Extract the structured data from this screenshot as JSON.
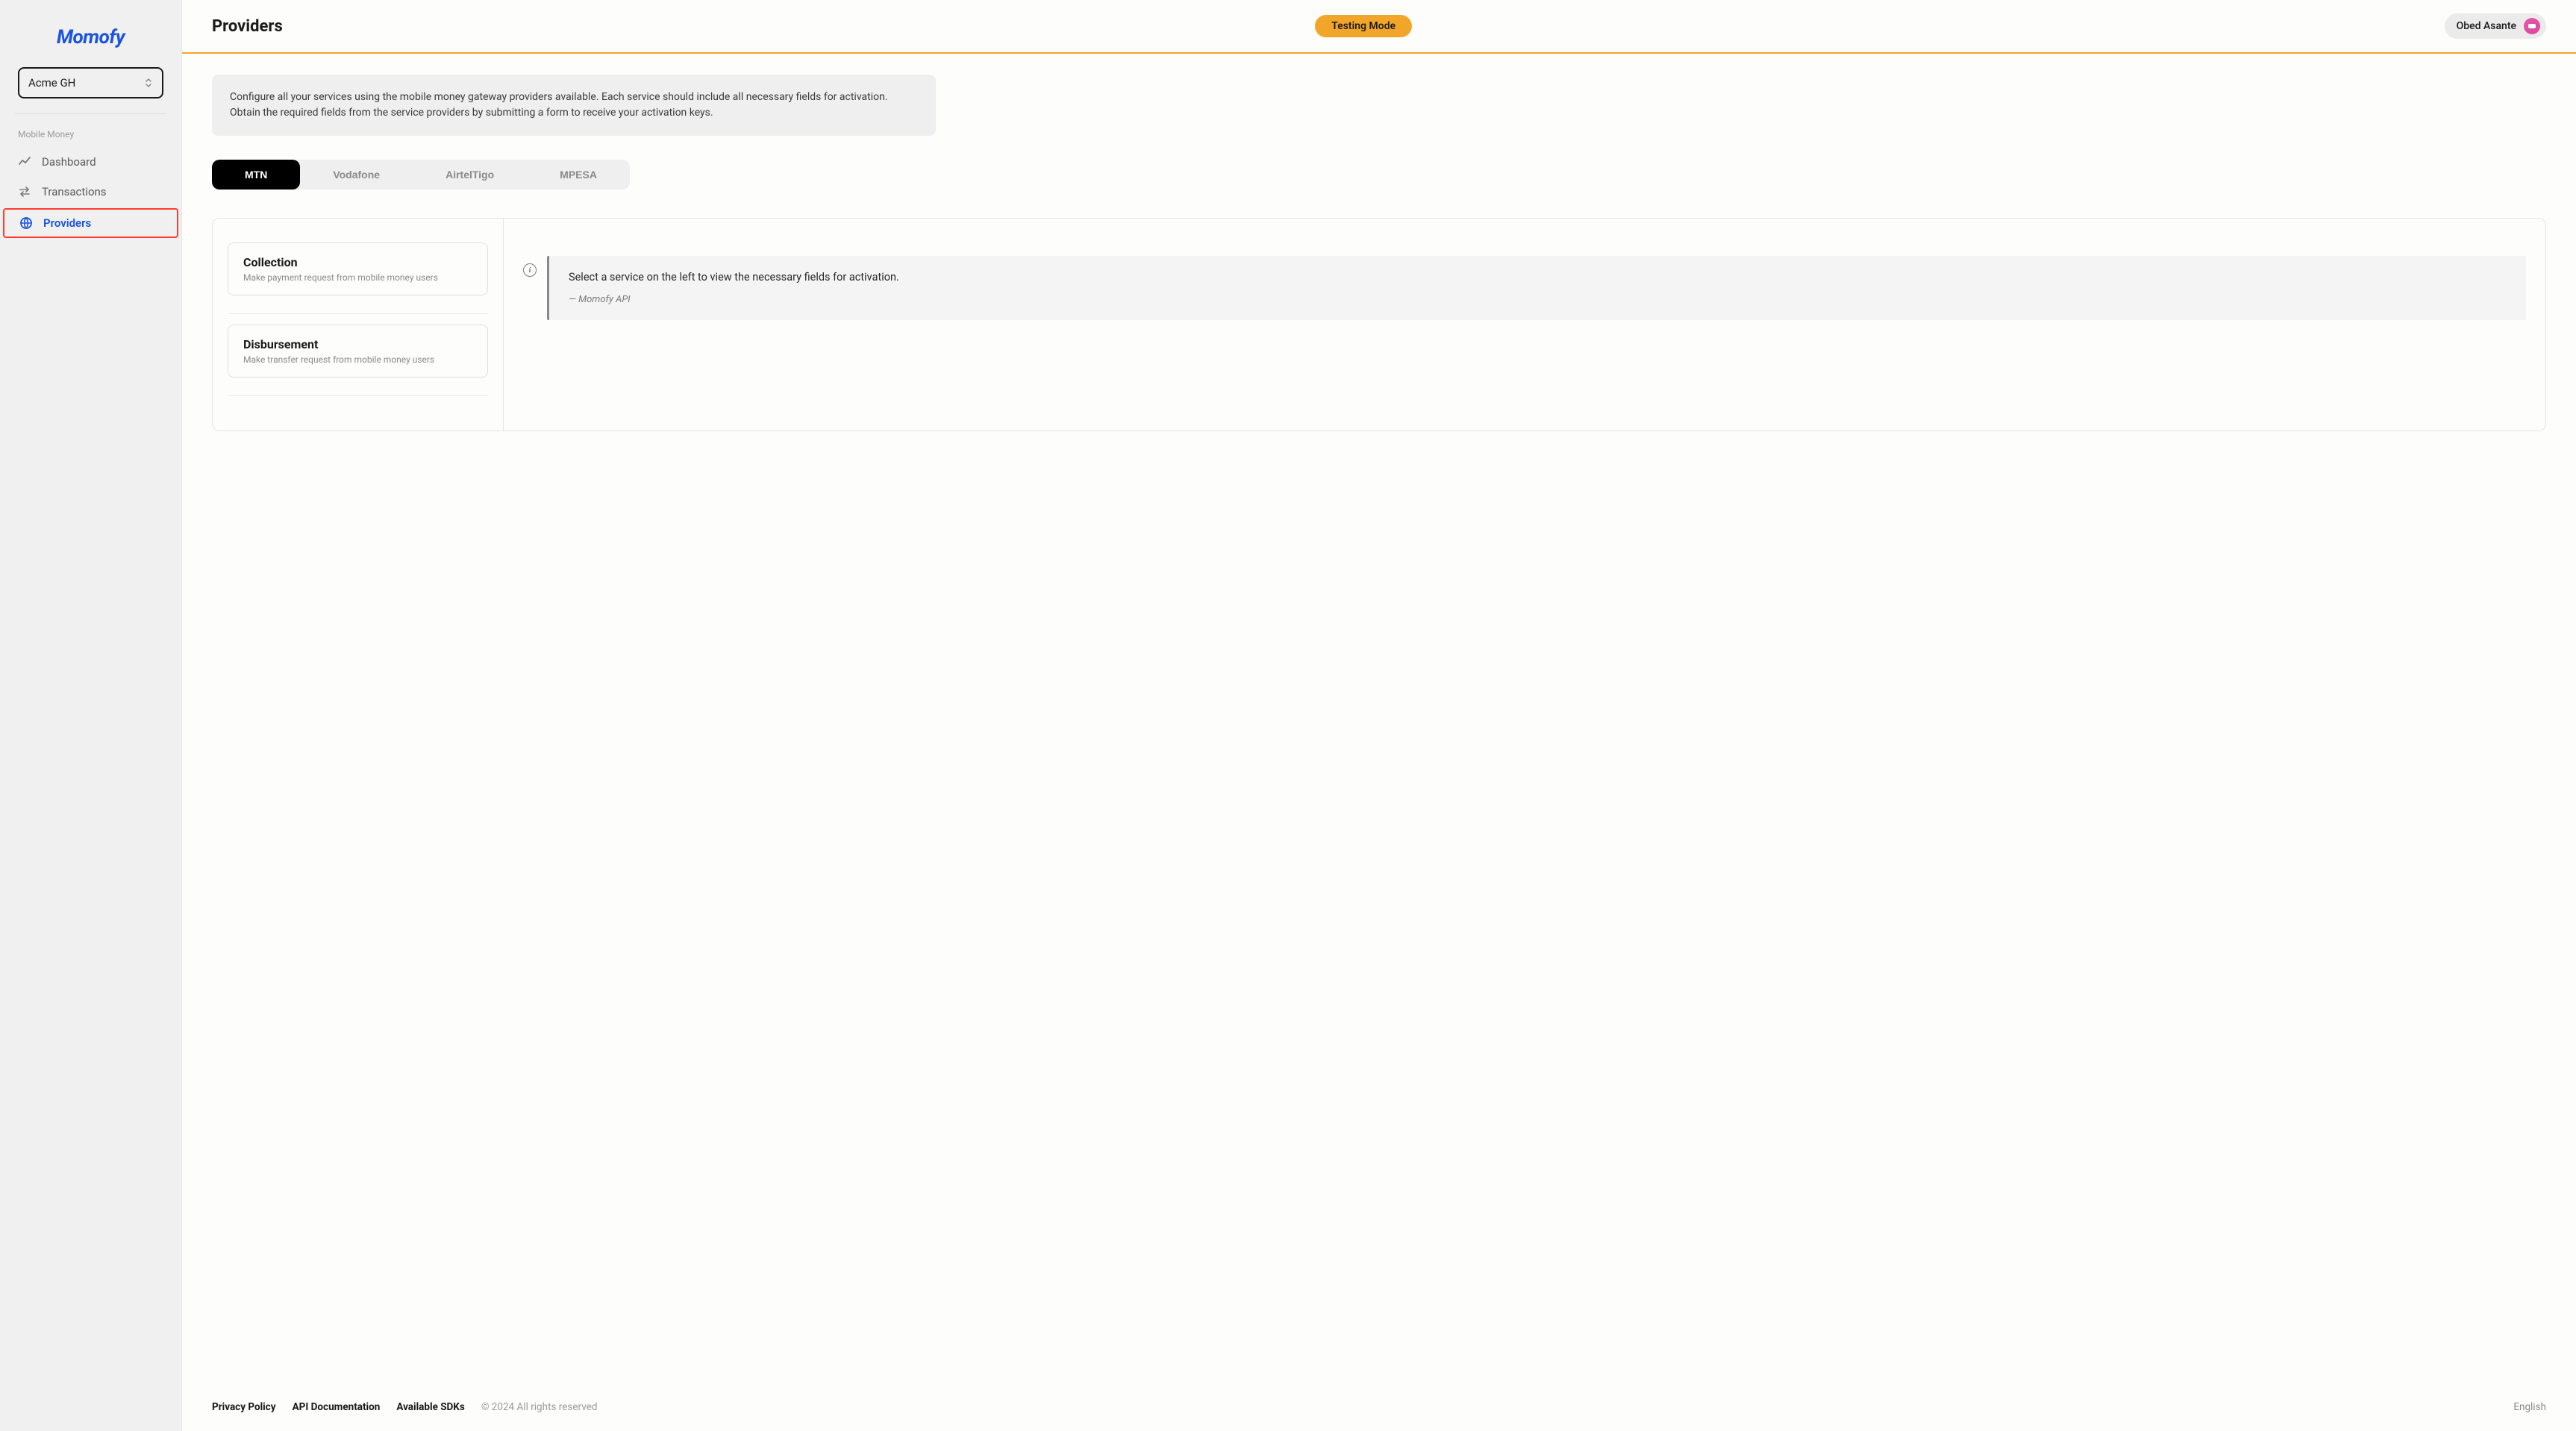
{
  "brand": "Momofy",
  "org_selector": {
    "value": "Acme GH"
  },
  "sidebar": {
    "section_label": "Mobile Money",
    "items": [
      {
        "label": "Dashboard"
      },
      {
        "label": "Transactions"
      },
      {
        "label": "Providers"
      }
    ]
  },
  "header": {
    "title": "Providers",
    "mode_badge": "Testing Mode",
    "user_name": "Obed Asante"
  },
  "banner": {
    "text": "Configure all your services using the mobile money gateway providers available. Each service should include all necessary fields for activation. Obtain the required fields from the service providers by submitting a form to receive your activation keys."
  },
  "tabs": [
    {
      "label": "MTN"
    },
    {
      "label": "Vodafone"
    },
    {
      "label": "AirtelTigo"
    },
    {
      "label": "MPESA"
    }
  ],
  "services": [
    {
      "title": "Collection",
      "desc": "Make payment request from mobile money users"
    },
    {
      "title": "Disbursement",
      "desc": "Make transfer request from mobile money users"
    }
  ],
  "detail": {
    "message": "Select a service on the left to view the necessary fields for activation.",
    "source": "— Momofy API"
  },
  "footer": {
    "links": [
      {
        "label": "Privacy Policy"
      },
      {
        "label": "API Documentation"
      },
      {
        "label": "Available SDKs"
      }
    ],
    "copyright": "© 2024 All rights reserved",
    "language": "English"
  }
}
